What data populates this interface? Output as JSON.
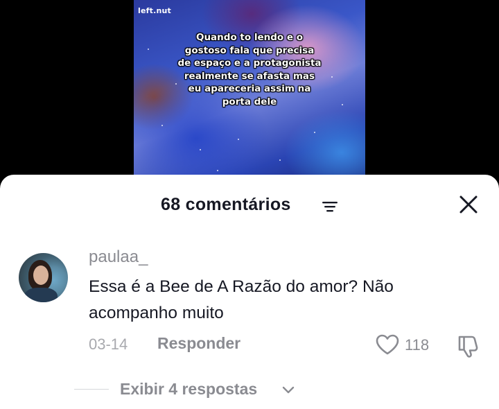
{
  "video": {
    "watermark": "left.nut",
    "caption": "Quando to lendo e o\ngostoso fala que precisa\nde espaço e a protagonista\nrealmente se afasta mas\neu apareceria assim na\nporta dele"
  },
  "comments_sheet": {
    "title": "68 comentários",
    "filter_icon": "filter-icon",
    "close_icon": "close-icon"
  },
  "comment": {
    "username": "paulaa_",
    "text": "Essa é a Bee de A Razão do amor? Não acompanho muito",
    "date": "03-14",
    "reply_label": "Responder",
    "like_count": "118",
    "view_replies_label": "Exibir 4 respostas",
    "icons": [
      "heart-icon",
      "dislike-icon",
      "chevron-down-icon"
    ]
  },
  "colors": {
    "text_primary": "#161823",
    "text_secondary": "#8a8b91",
    "sheet_background": "#ffffff",
    "backdrop": "#000000"
  }
}
